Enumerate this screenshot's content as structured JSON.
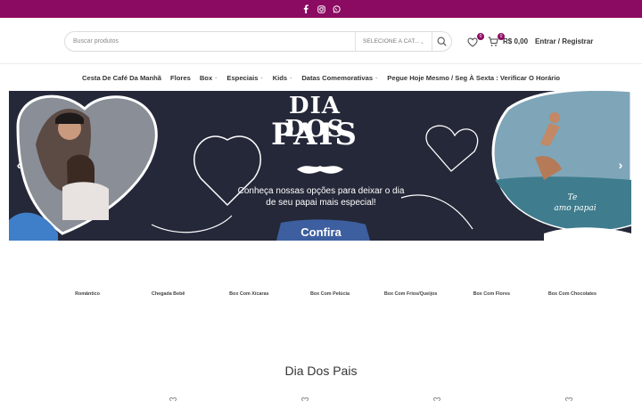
{
  "topbar": {
    "icons": [
      "facebook-icon",
      "instagram-icon",
      "whatsapp-icon"
    ],
    "bg": "#8c0b62"
  },
  "header": {
    "search_placeholder": "Buscar produtos",
    "category_select": "SELECIONE A CAT...",
    "wishlist_count": "0",
    "cart_count": "0",
    "cart_total": "R$ 0,00",
    "login_label": "Entrar / Registrar"
  },
  "nav": {
    "items": [
      {
        "label": "Cesta De Café Da Manhã"
      },
      {
        "label": "Flores"
      },
      {
        "label": "Box"
      },
      {
        "label": "Especiais"
      },
      {
        "label": "Kids"
      },
      {
        "label": "Datas Comemorativas"
      },
      {
        "label": "Pegue Hoje Mesmo / Seg À Sexta : Verificar O Horário"
      }
    ]
  },
  "banner": {
    "title_line1": "DIA DOS",
    "title_line2": "PAIS",
    "subtitle_line1": "Conheça nossas opções para deixar o dia",
    "subtitle_line2": "de seu papai mais especial!",
    "cta": "Confira",
    "handwriting_line1": "Te",
    "handwriting_line2": "amo papai",
    "bg": "#252839"
  },
  "categories": [
    {
      "label": "Romântico"
    },
    {
      "label": "Chegada Bebê"
    },
    {
      "label": "Box Com Xícaras"
    },
    {
      "label": "Box Com Pelúcia"
    },
    {
      "label": "Box Com Frios/Queijos"
    },
    {
      "label": "Box Com Flores"
    },
    {
      "label": "Box Com Chocolates"
    }
  ],
  "section": {
    "title": "Dia Dos Pais"
  }
}
